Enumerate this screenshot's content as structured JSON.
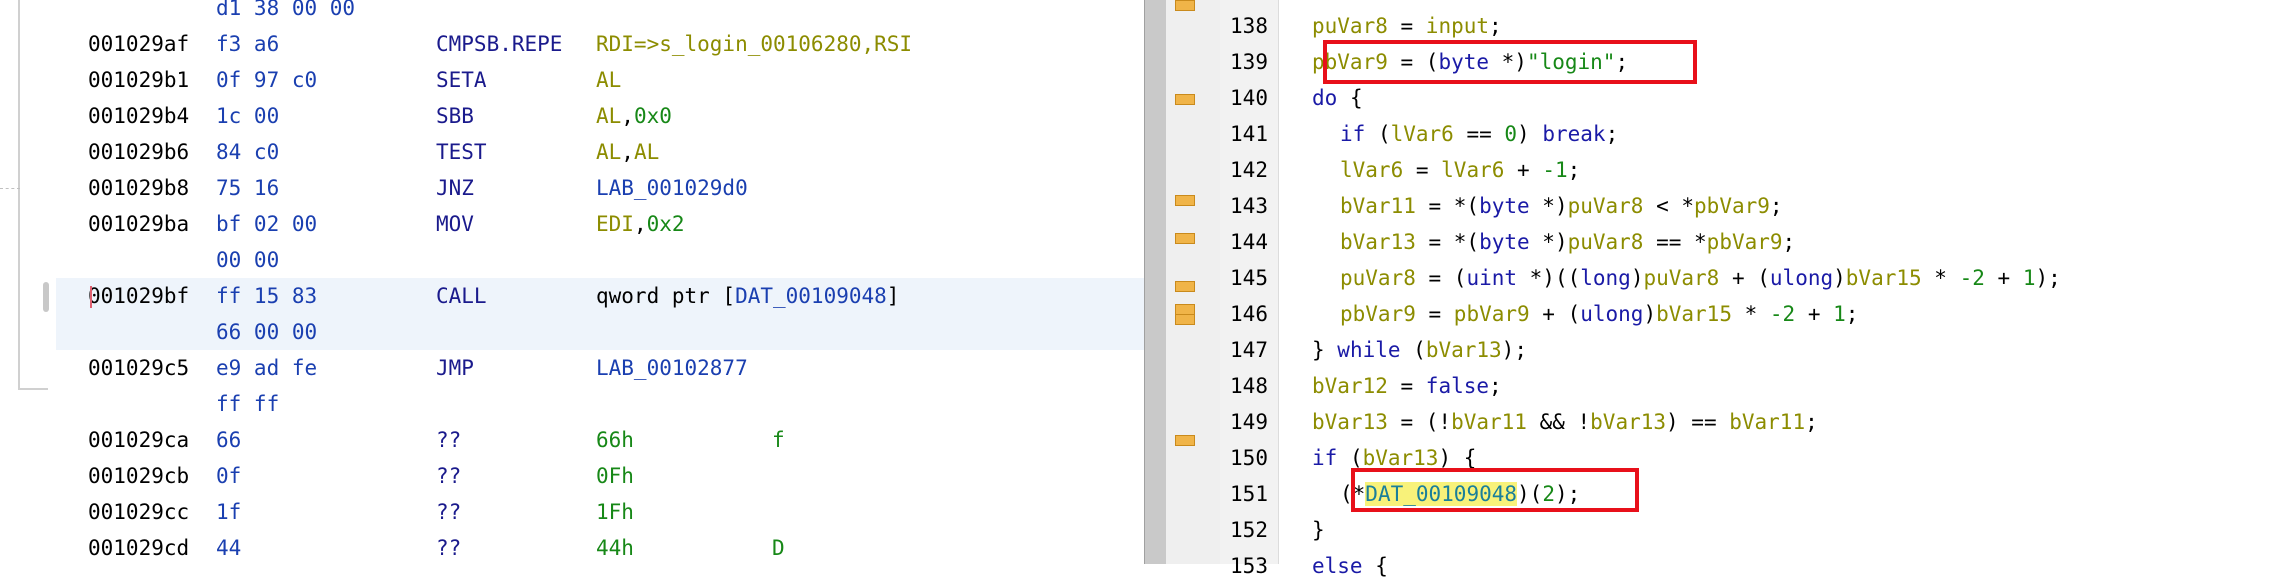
{
  "listing": {
    "rows": [
      {
        "addr": "",
        "bytes": "d1 38 00 00",
        "mnem": "",
        "ops": []
      },
      {
        "addr": "001029af",
        "bytes": "f3 a6",
        "mnem": "CMPSB.REPE",
        "ops": [
          {
            "t": "RDI=>s_login_00106280,RSI",
            "c": "reg"
          }
        ]
      },
      {
        "addr": "001029b1",
        "bytes": "0f 97 c0",
        "mnem": "SETA",
        "ops": [
          {
            "t": "AL",
            "c": "reg"
          }
        ]
      },
      {
        "addr": "001029b4",
        "bytes": "1c 00",
        "mnem": "SBB",
        "ops": [
          {
            "t": "AL",
            "c": "reg"
          },
          {
            "t": ",",
            "c": "plain"
          },
          {
            "t": "0x0",
            "c": "num"
          }
        ]
      },
      {
        "addr": "001029b6",
        "bytes": "84 c0",
        "mnem": "TEST",
        "ops": [
          {
            "t": "AL",
            "c": "reg"
          },
          {
            "t": ",",
            "c": "plain"
          },
          {
            "t": "AL",
            "c": "reg"
          }
        ]
      },
      {
        "addr": "001029b8",
        "bytes": "75 16",
        "mnem": "JNZ",
        "ops": [
          {
            "t": "LAB_001029d0",
            "c": "lbl"
          }
        ]
      },
      {
        "addr": "001029ba",
        "bytes": "bf 02 00",
        "mnem": "MOV",
        "ops": [
          {
            "t": "EDI",
            "c": "reg"
          },
          {
            "t": ",",
            "c": "plain"
          },
          {
            "t": "0x2",
            "c": "num"
          }
        ]
      },
      {
        "addr": "",
        "bytes": "00 00",
        "mnem": "",
        "ops": []
      },
      {
        "addr": "001029bf",
        "bytes": "ff 15 83",
        "mnem": "CALL",
        "ops": [
          {
            "t": "qword ptr [",
            "c": "plain"
          },
          {
            "t": "DAT_00109048",
            "c": "lbl"
          },
          {
            "t": "]",
            "c": "plain"
          }
        ]
      },
      {
        "addr": "",
        "bytes": "66 00 00",
        "mnem": "",
        "ops": []
      },
      {
        "addr": "001029c5",
        "bytes": "e9 ad fe",
        "mnem": "JMP",
        "ops": [
          {
            "t": "LAB_00102877",
            "c": "lbl"
          }
        ]
      },
      {
        "addr": "",
        "bytes": "ff ff",
        "mnem": "",
        "ops": []
      },
      {
        "addr": "001029ca",
        "bytes": "66",
        "mnem": "??",
        "ops": [
          {
            "t": "66h",
            "c": "num"
          }
        ],
        "ascii": "f"
      },
      {
        "addr": "001029cb",
        "bytes": "0f",
        "mnem": "??",
        "ops": [
          {
            "t": "0Fh",
            "c": "num"
          }
        ]
      },
      {
        "addr": "001029cc",
        "bytes": "1f",
        "mnem": "??",
        "ops": [
          {
            "t": "1Fh",
            "c": "num"
          }
        ]
      },
      {
        "addr": "001029cd",
        "bytes": "44",
        "mnem": "??",
        "ops": [
          {
            "t": "44h",
            "c": "num"
          }
        ],
        "ascii": "D"
      }
    ]
  },
  "decompiler": {
    "lines": [
      {
        "num": "138",
        "indent": 1,
        "tokens": [
          [
            "v",
            "puVar8"
          ],
          [
            "p",
            " = "
          ],
          [
            "v",
            "input"
          ],
          [
            "p",
            ";"
          ]
        ]
      },
      {
        "num": "139",
        "indent": 1,
        "tokens": [
          [
            "v",
            "pbVar9"
          ],
          [
            "p",
            " = ("
          ],
          [
            "k",
            "byte"
          ],
          [
            "p",
            " *)"
          ],
          [
            "s",
            "\"login\""
          ],
          [
            "p",
            ";"
          ]
        ]
      },
      {
        "num": "140",
        "indent": 1,
        "tokens": [
          [
            "k",
            "do"
          ],
          [
            "p",
            " {"
          ]
        ]
      },
      {
        "num": "141",
        "indent": 2,
        "tokens": [
          [
            "k",
            "if"
          ],
          [
            "p",
            " ("
          ],
          [
            "v",
            "lVar6"
          ],
          [
            "p",
            " == "
          ],
          [
            "n",
            "0"
          ],
          [
            "p",
            ") "
          ],
          [
            "k",
            "break"
          ],
          [
            "p",
            ";"
          ]
        ]
      },
      {
        "num": "142",
        "indent": 2,
        "tokens": [
          [
            "v",
            "lVar6"
          ],
          [
            "p",
            " = "
          ],
          [
            "v",
            "lVar6"
          ],
          [
            "p",
            " + "
          ],
          [
            "n",
            "-1"
          ],
          [
            "p",
            ";"
          ]
        ]
      },
      {
        "num": "143",
        "indent": 2,
        "tokens": [
          [
            "v",
            "bVar11"
          ],
          [
            "p",
            " = *("
          ],
          [
            "k",
            "byte"
          ],
          [
            "p",
            " *)"
          ],
          [
            "v",
            "puVar8"
          ],
          [
            "p",
            " < *"
          ],
          [
            "v",
            "pbVar9"
          ],
          [
            "p",
            ";"
          ]
        ]
      },
      {
        "num": "144",
        "indent": 2,
        "tokens": [
          [
            "v",
            "bVar13"
          ],
          [
            "p",
            " = *("
          ],
          [
            "k",
            "byte"
          ],
          [
            "p",
            " *)"
          ],
          [
            "v",
            "puVar8"
          ],
          [
            "p",
            " == *"
          ],
          [
            "v",
            "pbVar9"
          ],
          [
            "p",
            ";"
          ]
        ]
      },
      {
        "num": "145",
        "indent": 2,
        "tokens": [
          [
            "v",
            "puVar8"
          ],
          [
            "p",
            " = ("
          ],
          [
            "k",
            "uint"
          ],
          [
            "p",
            " *)(("
          ],
          [
            "k",
            "long"
          ],
          [
            "p",
            ")"
          ],
          [
            "v",
            "puVar8"
          ],
          [
            "p",
            " + ("
          ],
          [
            "k",
            "ulong"
          ],
          [
            "p",
            ")"
          ],
          [
            "v",
            "bVar15"
          ],
          [
            "p",
            " * "
          ],
          [
            "n",
            "-2"
          ],
          [
            "p",
            " + "
          ],
          [
            "n",
            "1"
          ],
          [
            "p",
            ");"
          ]
        ]
      },
      {
        "num": "146",
        "indent": 2,
        "tokens": [
          [
            "v",
            "pbVar9"
          ],
          [
            "p",
            " = "
          ],
          [
            "v",
            "pbVar9"
          ],
          [
            "p",
            " + ("
          ],
          [
            "k",
            "ulong"
          ],
          [
            "p",
            ")"
          ],
          [
            "v",
            "bVar15"
          ],
          [
            "p",
            " * "
          ],
          [
            "n",
            "-2"
          ],
          [
            "p",
            " + "
          ],
          [
            "n",
            "1"
          ],
          [
            "p",
            ";"
          ]
        ]
      },
      {
        "num": "147",
        "indent": 1,
        "tokens": [
          [
            "p",
            "} "
          ],
          [
            "k",
            "while"
          ],
          [
            "p",
            " ("
          ],
          [
            "v",
            "bVar13"
          ],
          [
            "p",
            ");"
          ]
        ]
      },
      {
        "num": "148",
        "indent": 1,
        "tokens": [
          [
            "v",
            "bVar12"
          ],
          [
            "p",
            " = "
          ],
          [
            "k",
            "false"
          ],
          [
            "p",
            ";"
          ]
        ]
      },
      {
        "num": "149",
        "indent": 1,
        "tokens": [
          [
            "v",
            "bVar13"
          ],
          [
            "p",
            " = (!"
          ],
          [
            "v",
            "bVar11"
          ],
          [
            "p",
            " && !"
          ],
          [
            "v",
            "bVar13"
          ],
          [
            "p",
            ") == "
          ],
          [
            "v",
            "bVar11"
          ],
          [
            "p",
            ";"
          ]
        ]
      },
      {
        "num": "150",
        "indent": 1,
        "tokens": [
          [
            "k",
            "if"
          ],
          [
            "p",
            " ("
          ],
          [
            "v",
            "bVar13"
          ],
          [
            "p",
            ") {"
          ]
        ]
      },
      {
        "num": "151",
        "indent": 2,
        "tokens": [
          [
            "p",
            "(*"
          ],
          [
            "y",
            "DAT_00109048"
          ],
          [
            "p",
            ")("
          ],
          [
            "n",
            "2"
          ],
          [
            "p",
            ");"
          ]
        ]
      },
      {
        "num": "152",
        "indent": 1,
        "tokens": [
          [
            "p",
            "}"
          ]
        ]
      },
      {
        "num": "153",
        "indent": 1,
        "tokens": [
          [
            "k",
            "else"
          ],
          [
            "p",
            " {"
          ]
        ]
      }
    ]
  }
}
